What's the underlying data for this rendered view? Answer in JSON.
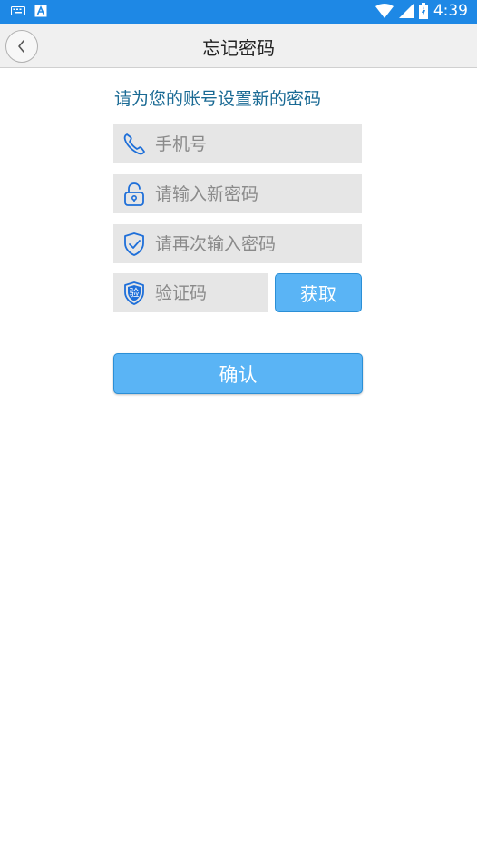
{
  "status_bar": {
    "time": "4:39",
    "background": "#1e88e5"
  },
  "header": {
    "title": "忘记密码",
    "back_icon": "chevron-left-icon"
  },
  "form": {
    "subtitle": "请为您的账号设置新的密码",
    "phone": {
      "placeholder": "手机号",
      "value": "",
      "icon": "phone-icon"
    },
    "new_password": {
      "placeholder": "请输入新密码",
      "value": "",
      "icon": "lock-icon"
    },
    "confirm_password": {
      "placeholder": "请再次输入密码",
      "value": "",
      "icon": "shield-check-icon"
    },
    "code": {
      "placeholder": "验证码",
      "value": "",
      "icon": "verify-shield-icon",
      "icon_text": "验"
    },
    "get_code_label": "获取",
    "confirm_label": "确认"
  },
  "colors": {
    "accent": "#5ab4f5",
    "accent_border": "#2b8fd6",
    "icon": "#1e6fd9",
    "subtitle": "#1a6a94",
    "field_bg": "#e6e6e6"
  }
}
